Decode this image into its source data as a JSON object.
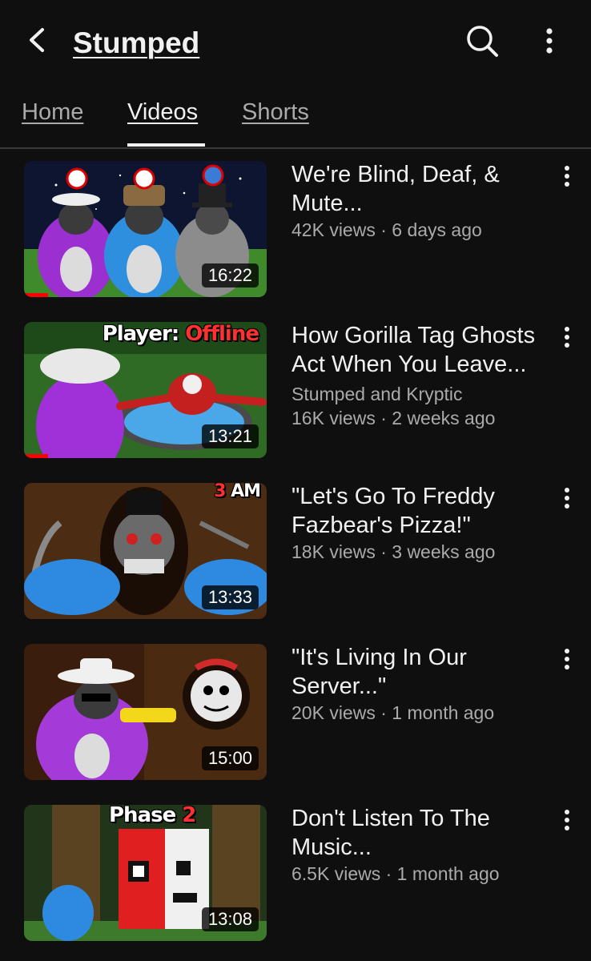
{
  "header": {
    "back_icon": "arrow-left-icon",
    "title": "Stumped",
    "search_icon": "search-icon",
    "more_icon": "more-vert-icon"
  },
  "tabs": [
    {
      "label": "Home",
      "active": false
    },
    {
      "label": "Videos",
      "active": true
    },
    {
      "label": "Shorts",
      "active": false
    }
  ],
  "colors": {
    "background": "#0f0f0f",
    "text_primary": "#f1f1f1",
    "text_secondary": "#aaaaaa",
    "progress": "#ff0000"
  },
  "videos": [
    {
      "title": "We're Blind, Deaf, & Mute...",
      "views_age": "42K views · 6 days ago",
      "duration": "16:22",
      "watched_fraction": 0.1
    },
    {
      "title": "How Gorilla Tag Ghosts Act When You Leave...",
      "channel": "Stumped and Kryptic",
      "views_age": "16K views · 2 weeks ago",
      "duration": "13:21",
      "overlay_white": "Player: ",
      "overlay_red": "Offline",
      "watched_fraction": 0.1
    },
    {
      "title": "\"Let's Go To Freddy Fazbear's Pizza!\"",
      "views_age": "18K views · 3 weeks ago",
      "duration": "13:33",
      "overlay_red": "3 ",
      "overlay_white": "AM"
    },
    {
      "title": "\"It's Living In Our Server...\"",
      "views_age": "20K views · 1 month ago",
      "duration": "15:00"
    },
    {
      "title": "Don't Listen To The Music...",
      "views_age": "6.5K views · 1 month ago",
      "duration": "13:08",
      "overlay_white": "Phase ",
      "overlay_red": "2"
    }
  ]
}
